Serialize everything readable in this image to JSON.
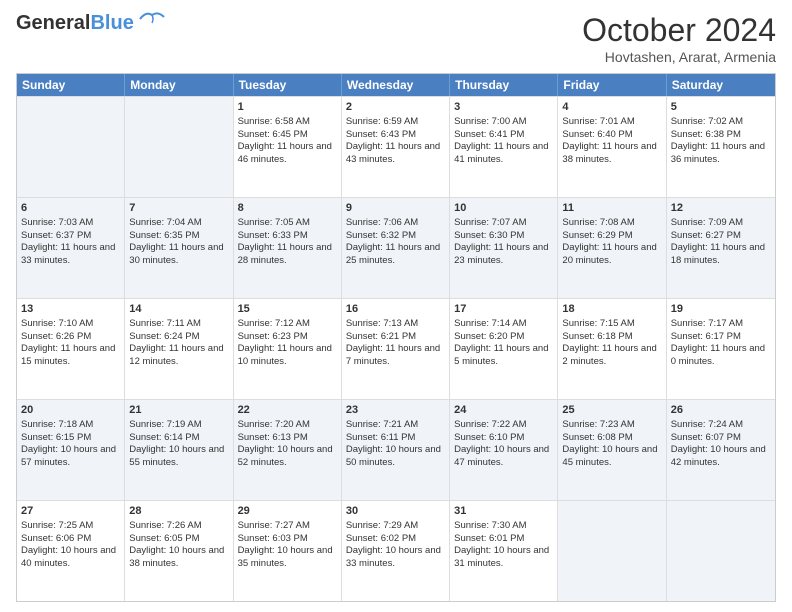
{
  "header": {
    "logo_general": "General",
    "logo_blue": "Blue",
    "month": "October 2024",
    "location": "Hovtashen, Ararat, Armenia"
  },
  "weekdays": [
    "Sunday",
    "Monday",
    "Tuesday",
    "Wednesday",
    "Thursday",
    "Friday",
    "Saturday"
  ],
  "rows": [
    {
      "shade": "white",
      "cells": [
        {
          "day": "",
          "info": ""
        },
        {
          "day": "",
          "info": ""
        },
        {
          "day": "1",
          "info": "Sunrise: 6:58 AM\nSunset: 6:45 PM\nDaylight: 11 hours and 46 minutes."
        },
        {
          "day": "2",
          "info": "Sunrise: 6:59 AM\nSunset: 6:43 PM\nDaylight: 11 hours and 43 minutes."
        },
        {
          "day": "3",
          "info": "Sunrise: 7:00 AM\nSunset: 6:41 PM\nDaylight: 11 hours and 41 minutes."
        },
        {
          "day": "4",
          "info": "Sunrise: 7:01 AM\nSunset: 6:40 PM\nDaylight: 11 hours and 38 minutes."
        },
        {
          "day": "5",
          "info": "Sunrise: 7:02 AM\nSunset: 6:38 PM\nDaylight: 11 hours and 36 minutes."
        }
      ]
    },
    {
      "shade": "blue",
      "cells": [
        {
          "day": "6",
          "info": "Sunrise: 7:03 AM\nSunset: 6:37 PM\nDaylight: 11 hours and 33 minutes."
        },
        {
          "day": "7",
          "info": "Sunrise: 7:04 AM\nSunset: 6:35 PM\nDaylight: 11 hours and 30 minutes."
        },
        {
          "day": "8",
          "info": "Sunrise: 7:05 AM\nSunset: 6:33 PM\nDaylight: 11 hours and 28 minutes."
        },
        {
          "day": "9",
          "info": "Sunrise: 7:06 AM\nSunset: 6:32 PM\nDaylight: 11 hours and 25 minutes."
        },
        {
          "day": "10",
          "info": "Sunrise: 7:07 AM\nSunset: 6:30 PM\nDaylight: 11 hours and 23 minutes."
        },
        {
          "day": "11",
          "info": "Sunrise: 7:08 AM\nSunset: 6:29 PM\nDaylight: 11 hours and 20 minutes."
        },
        {
          "day": "12",
          "info": "Sunrise: 7:09 AM\nSunset: 6:27 PM\nDaylight: 11 hours and 18 minutes."
        }
      ]
    },
    {
      "shade": "white",
      "cells": [
        {
          "day": "13",
          "info": "Sunrise: 7:10 AM\nSunset: 6:26 PM\nDaylight: 11 hours and 15 minutes."
        },
        {
          "day": "14",
          "info": "Sunrise: 7:11 AM\nSunset: 6:24 PM\nDaylight: 11 hours and 12 minutes."
        },
        {
          "day": "15",
          "info": "Sunrise: 7:12 AM\nSunset: 6:23 PM\nDaylight: 11 hours and 10 minutes."
        },
        {
          "day": "16",
          "info": "Sunrise: 7:13 AM\nSunset: 6:21 PM\nDaylight: 11 hours and 7 minutes."
        },
        {
          "day": "17",
          "info": "Sunrise: 7:14 AM\nSunset: 6:20 PM\nDaylight: 11 hours and 5 minutes."
        },
        {
          "day": "18",
          "info": "Sunrise: 7:15 AM\nSunset: 6:18 PM\nDaylight: 11 hours and 2 minutes."
        },
        {
          "day": "19",
          "info": "Sunrise: 7:17 AM\nSunset: 6:17 PM\nDaylight: 11 hours and 0 minutes."
        }
      ]
    },
    {
      "shade": "blue",
      "cells": [
        {
          "day": "20",
          "info": "Sunrise: 7:18 AM\nSunset: 6:15 PM\nDaylight: 10 hours and 57 minutes."
        },
        {
          "day": "21",
          "info": "Sunrise: 7:19 AM\nSunset: 6:14 PM\nDaylight: 10 hours and 55 minutes."
        },
        {
          "day": "22",
          "info": "Sunrise: 7:20 AM\nSunset: 6:13 PM\nDaylight: 10 hours and 52 minutes."
        },
        {
          "day": "23",
          "info": "Sunrise: 7:21 AM\nSunset: 6:11 PM\nDaylight: 10 hours and 50 minutes."
        },
        {
          "day": "24",
          "info": "Sunrise: 7:22 AM\nSunset: 6:10 PM\nDaylight: 10 hours and 47 minutes."
        },
        {
          "day": "25",
          "info": "Sunrise: 7:23 AM\nSunset: 6:08 PM\nDaylight: 10 hours and 45 minutes."
        },
        {
          "day": "26",
          "info": "Sunrise: 7:24 AM\nSunset: 6:07 PM\nDaylight: 10 hours and 42 minutes."
        }
      ]
    },
    {
      "shade": "white",
      "cells": [
        {
          "day": "27",
          "info": "Sunrise: 7:25 AM\nSunset: 6:06 PM\nDaylight: 10 hours and 40 minutes."
        },
        {
          "day": "28",
          "info": "Sunrise: 7:26 AM\nSunset: 6:05 PM\nDaylight: 10 hours and 38 minutes."
        },
        {
          "day": "29",
          "info": "Sunrise: 7:27 AM\nSunset: 6:03 PM\nDaylight: 10 hours and 35 minutes."
        },
        {
          "day": "30",
          "info": "Sunrise: 7:29 AM\nSunset: 6:02 PM\nDaylight: 10 hours and 33 minutes."
        },
        {
          "day": "31",
          "info": "Sunrise: 7:30 AM\nSunset: 6:01 PM\nDaylight: 10 hours and 31 minutes."
        },
        {
          "day": "",
          "info": ""
        },
        {
          "day": "",
          "info": ""
        }
      ]
    }
  ]
}
